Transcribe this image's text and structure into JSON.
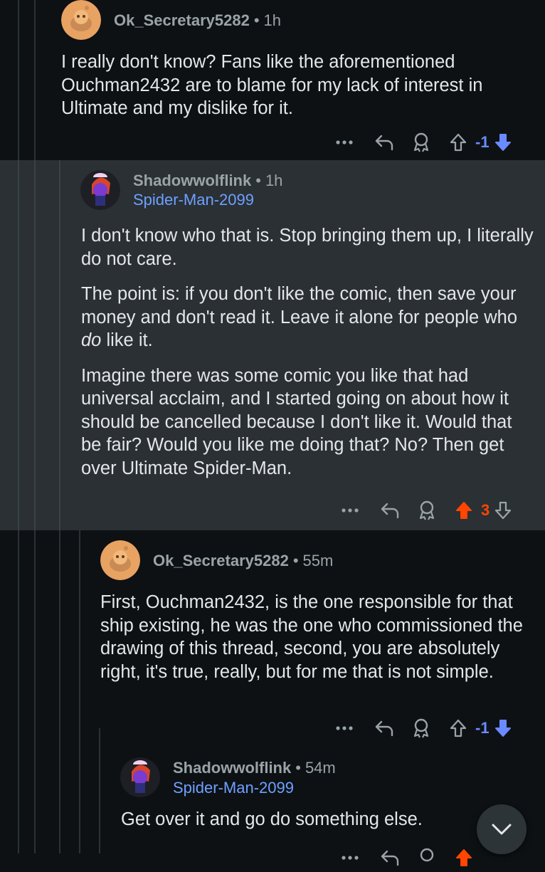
{
  "comments": [
    {
      "author": "Ok_Secretary5282",
      "time": "1h",
      "paragraphs": [
        "I really don't know? Fans like the aforementioned Ouchman2432 are to blame for my lack of interest in Ultimate and my dislike for it."
      ],
      "score": "-1",
      "vote": "down"
    },
    {
      "author": "Shadowwolflink",
      "time": "1h",
      "flair": "Spider-Man-2099",
      "paragraphs": [
        "I don't know who that is. Stop bringing them up, I literally do not care.",
        "The point is: if you don't like the comic, then save your money and don't read it. Leave it alone for people who",
        "do",
        "like it.",
        "Imagine there was some comic you like that had universal acclaim, and I started going on about how it should be cancelled because I don't like it. Would that be fair? Would you like me doing that? No? Then get over Ultimate Spider-Man."
      ],
      "score": "3",
      "vote": "up"
    },
    {
      "author": "Ok_Secretary5282",
      "time": "55m",
      "paragraphs": [
        "First, Ouchman2432, is the one responsible for that ship existing, he was the one who commissioned the drawing of this thread, second, you are absolutely right, it's true, really, but for me that is not simple."
      ],
      "score": "-1",
      "vote": "down"
    },
    {
      "author": "Shadowwolflink",
      "time": "54m",
      "flair": "Spider-Man-2099",
      "paragraphs": [
        "Get over it and go do something else."
      ]
    }
  ],
  "colors": {
    "background": "#0d1114",
    "highlight_background": "#2a3034",
    "downvote": "#6a8bff",
    "upvote": "#ff4500",
    "flair": "#6fa0ff"
  },
  "icons": [
    "more-icon",
    "reply-icon",
    "award-icon",
    "upvote-icon",
    "downvote-icon",
    "scroll-down-icon"
  ]
}
